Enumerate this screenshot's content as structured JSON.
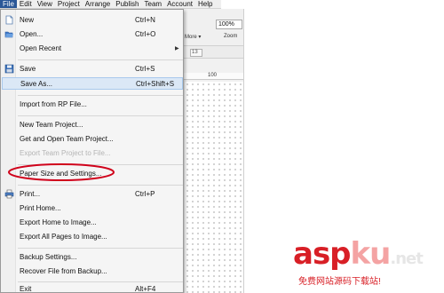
{
  "menubar": {
    "items": [
      "File",
      "Edit",
      "View",
      "Project",
      "Arrange",
      "Publish",
      "Team",
      "Account",
      "Help"
    ]
  },
  "app": {
    "zoom_value": "100%",
    "zoom_label": "Zoom",
    "more_label": "More ▾",
    "font_size": "13",
    "ruler_label": "100"
  },
  "menu": {
    "items": [
      {
        "label": "New",
        "accel": "Ctrl+N",
        "icon": "new-file-icon"
      },
      {
        "label": "Open...",
        "accel": "Ctrl+O",
        "icon": "open-folder-icon"
      },
      {
        "label": "Open Recent",
        "accel": "",
        "submenu": true
      },
      {
        "label": "Save",
        "accel": "Ctrl+S",
        "icon": "save-icon"
      },
      {
        "label": "Save As...",
        "accel": "Ctrl+Shift+S",
        "highlighted": true
      },
      {
        "label": "Import from RP File..."
      },
      {
        "label": "New Team Project..."
      },
      {
        "label": "Get and Open Team Project..."
      },
      {
        "label": "Export Team Project to File...",
        "disabled": true
      },
      {
        "label": "Paper Size and Settings..."
      },
      {
        "label": "Print...",
        "accel": "Ctrl+P",
        "icon": "printer-icon"
      },
      {
        "label": "Print Home..."
      },
      {
        "label": "Export Home to Image..."
      },
      {
        "label": "Export All Pages to Image..."
      },
      {
        "label": "Backup Settings..."
      },
      {
        "label": "Recover File from Backup..."
      },
      {
        "label": "Exit",
        "accel": "Alt+F4"
      }
    ]
  },
  "watermark": {
    "asp": "asp",
    "ku": "ku",
    "net": ".net",
    "subtitle": "免费网站源码下载站!"
  },
  "colors": {
    "menu_highlight": "#dbe8f6",
    "annotation_red": "#d0021b",
    "watermark_red": "#d81f26"
  }
}
